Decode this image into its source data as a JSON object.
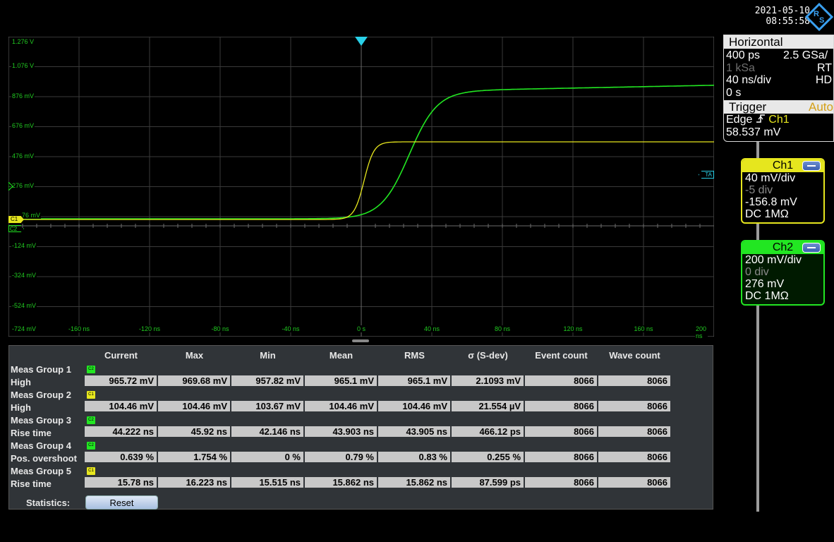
{
  "header": {
    "date": "2021-05-10",
    "time": "08:55:58",
    "logo_text": "R&S"
  },
  "scope": {
    "y_labels": [
      "1.276 V",
      "1.076 V",
      "876 mV",
      "676 mV",
      "476 mV",
      "276 mV",
      "76 mV",
      "-124 mV",
      "-324 mV",
      "-524 mV",
      "-724 mV"
    ],
    "x_labels": [
      "-160 ns",
      "-120 ns",
      "-80 ns",
      "-40 ns",
      "0 s",
      "40 ns",
      "80 ns",
      "120 ns",
      "160 ns",
      "200 ns"
    ],
    "markers": {
      "ch1": "C1",
      "ch2": "C2",
      "trigger_level": "TA"
    },
    "colors": {
      "ch1": "#e6e61e",
      "ch2": "#22e622",
      "grid": "#3a3a3a",
      "trigger": "#29d0e8"
    }
  },
  "meas": {
    "headers": [
      "Current",
      "Max",
      "Min",
      "Mean",
      "RMS",
      "σ (S-dev)",
      "Event count",
      "Wave count"
    ],
    "groups": [
      {
        "name": "Meas Group 1",
        "badge": "C2",
        "badge_color": "#22e622",
        "row_label": "High",
        "values": [
          "965.72 mV",
          "969.68 mV",
          "957.82 mV",
          "965.1 mV",
          "965.1 mV",
          "2.1093 mV",
          "8066",
          "8066"
        ]
      },
      {
        "name": "Meas Group 2",
        "badge": "C1",
        "badge_color": "#e6e61e",
        "row_label": "High",
        "values": [
          "104.46 mV",
          "104.46 mV",
          "103.67 mV",
          "104.46 mV",
          "104.46 mV",
          "21.554 µV",
          "8066",
          "8066"
        ]
      },
      {
        "name": "Meas Group 3",
        "badge": "C2",
        "badge_color": "#22e622",
        "row_label": "Rise time",
        "values": [
          "44.222 ns",
          "45.92 ns",
          "42.146 ns",
          "43.903 ns",
          "43.905 ns",
          "466.12 ps",
          "8066",
          "8066"
        ]
      },
      {
        "name": "Meas Group 4",
        "badge": "C2",
        "badge_color": "#22e622",
        "row_label": "Pos. overshoot",
        "values": [
          "0.639 %",
          "1.754 %",
          "0 %",
          "0.79 %",
          "0.83 %",
          "0.255 %",
          "8066",
          "8066"
        ]
      },
      {
        "name": "Meas Group 5",
        "badge": "C1",
        "badge_color": "#e6e61e",
        "row_label": "Rise time",
        "values": [
          "15.78 ns",
          "16.223 ns",
          "15.515 ns",
          "15.862 ns",
          "15.862 ns",
          "87.599 ps",
          "8066",
          "8066"
        ]
      }
    ],
    "statistics_label": "Statistics:",
    "reset_label": "Reset"
  },
  "horizontal": {
    "title": "Horizontal",
    "res": "400 ps",
    "srate": "2.5 GSa/",
    "rec_len": "1 kSa",
    "mode": "RT",
    "scale": "40 ns/div",
    "hd": "HD",
    "pos": "0 s"
  },
  "trigger": {
    "title": "Trigger",
    "mode": "Auto",
    "type": "Edge",
    "source": "Ch1",
    "level": "58.537 mV"
  },
  "ch1": {
    "title": "Ch1",
    "scale": "40 mV/div",
    "offset_div": "-5 div",
    "offset": "-156.8 mV",
    "coupling": "DC 1MΩ"
  },
  "ch2": {
    "title": "Ch2",
    "scale": "200 mV/div",
    "offset_div": "0 div",
    "offset": "276 mV",
    "coupling": "DC 1MΩ"
  }
}
